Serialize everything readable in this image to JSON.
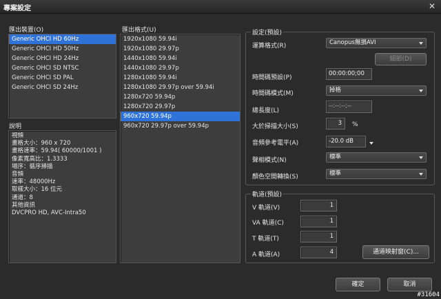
{
  "window": {
    "title": "專案設定",
    "close_glyph": "✕"
  },
  "output_device": {
    "label": "匯出裝置(O)",
    "items": [
      "Generic OHCI HD 60Hz",
      "Generic OHCI HD 50Hz",
      "Generic OHCI HD 24Hz",
      "Generic OHCI SD NTSC",
      "Generic OHCI SD PAL",
      "Generic OHCI SD 24Hz"
    ],
    "selected_index": 0
  },
  "output_format": {
    "label": "匯出格式(U)",
    "items": [
      "1920x1080 59.94i",
      "1920x1080 29.97p",
      "1440x1080 59.94i",
      "1440x1080 29.97p",
      "1280x1080 59.94i",
      "1280x1080 29.97p over 59.94i",
      "1280x720 59.94p",
      "1280x720 29.97p",
      "960x720 59.94p",
      "960x720 29.97p over 59.94p"
    ],
    "selected_index": 8
  },
  "description": {
    "label": "說明",
    "lines": [
      "視頻",
      "畫格大小：960 x 720",
      "畫格速率：59.94( 60000/1001 )",
      "像素寬高比：1.3333",
      "場序：循序掃描",
      "音頻",
      "速率：48000Hz",
      "取樣大小：16 位元",
      "通道：8",
      "其他資訊",
      "DVCPRO HD, AVC-Intra50"
    ]
  },
  "settings": {
    "title": "設定(預設)",
    "render_format": {
      "label": "運算格式(R)",
      "value": "Canopus無損AVI"
    },
    "detail_button": "細節(D)",
    "timecode_preset": {
      "label": "時間碼預設(P)",
      "value": "00:00:00;00"
    },
    "timecode_mode": {
      "label": "時間碼模式(M)",
      "value": "掉格"
    },
    "total_length": {
      "label": "總長度(L)",
      "value": "--:--:--;--"
    },
    "overscan": {
      "label": "大於掃描大小(S)",
      "value": "3",
      "unit": "%"
    },
    "audio_ref_level": {
      "label": "音頻參考電平(A)",
      "value": "-20.0 dB"
    },
    "field_mode": {
      "label": "聲相模式(N)",
      "value": "標準"
    },
    "color_space": {
      "label": "顏色空間轉換(S)",
      "value": "標準"
    }
  },
  "tracks": {
    "title": "軌道(預設)",
    "v": {
      "label": "V 軌道(V)",
      "value": "1"
    },
    "va": {
      "label": "VA 軌道(C)",
      "value": "1"
    },
    "t": {
      "label": "T 軌道(T)",
      "value": "1"
    },
    "a": {
      "label": "A 軌道(A)",
      "value": "4"
    },
    "mapping_button": "通道映射窗(C)..."
  },
  "footer": {
    "ok": "確定",
    "cancel": "取消"
  },
  "watermark": "#31604"
}
